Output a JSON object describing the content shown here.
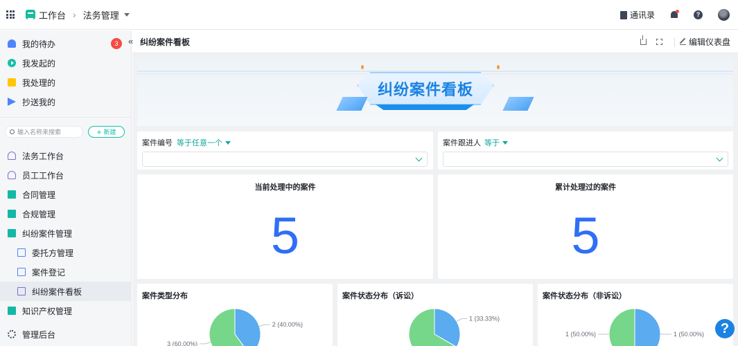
{
  "topbar": {
    "app_name": "工作台",
    "breadcrumb": "法务管理",
    "contacts_label": "通讯录",
    "icons": [
      "apps-grid-icon",
      "workbench-logo-icon",
      "chevron-right-icon",
      "caret-down-icon",
      "contacts-book-icon",
      "notification-bell-icon",
      "help-icon",
      "user-avatar"
    ]
  },
  "sidebar": {
    "quick_items": [
      {
        "label": "我的待办",
        "icon": "bell-icon",
        "badge": "3"
      },
      {
        "label": "我发起的",
        "icon": "play-circle-icon"
      },
      {
        "label": "我处理的",
        "icon": "check-box-icon"
      },
      {
        "label": "抄送我的",
        "icon": "send-icon"
      }
    ],
    "search_placeholder": "输入名称来搜索",
    "new_button": "新建",
    "nav_items": [
      {
        "label": "法务工作台",
        "icon": "user-icon"
      },
      {
        "label": "员工工作台",
        "icon": "user-icon"
      },
      {
        "label": "合同管理",
        "icon": "folder-icon"
      },
      {
        "label": "合规管理",
        "icon": "folder-icon"
      },
      {
        "label": "纠纷案件管理",
        "icon": "folder-icon"
      },
      {
        "label": "委托方管理",
        "icon": "document-icon"
      },
      {
        "label": "案件登记",
        "icon": "document-icon"
      },
      {
        "label": "纠纷案件看板",
        "icon": "dashboard-icon",
        "active": true
      },
      {
        "label": "知识产权管理",
        "icon": "folder-icon"
      }
    ],
    "admin_label": "管理后台"
  },
  "header": {
    "title": "纠纷案件看板",
    "edit_label": "编辑仪表盘"
  },
  "banner": {
    "title": "纠纷案件看板"
  },
  "filters": [
    {
      "label": "案件编号",
      "operator": "等于任意一个"
    },
    {
      "label": "案件跟进人",
      "operator": "等于"
    }
  ],
  "metrics": [
    {
      "title": "当前处理中的案件",
      "value": "5"
    },
    {
      "title": "累计处理过的案件",
      "value": "5"
    }
  ],
  "chart_data": [
    {
      "type": "pie",
      "title": "案件类型分布",
      "slices": [
        {
          "value": 2,
          "label": "2 (40.00%)",
          "color": "#5aabf0"
        },
        {
          "value": 3,
          "label": "3 (60.00%)",
          "color": "#76d68a"
        }
      ]
    },
    {
      "type": "pie",
      "title": "案件状态分布（诉讼）",
      "slices": [
        {
          "value": 1,
          "label": "1 (33.33%)",
          "color": "#5aabf0"
        },
        {
          "value": 2,
          "label": "",
          "color": "#76d68a"
        }
      ]
    },
    {
      "type": "pie",
      "title": "案件状态分布（非诉讼）",
      "slices": [
        {
          "value": 1,
          "label": "1 (50.00%)",
          "color": "#5aabf0"
        },
        {
          "value": 1,
          "label": "1 (50.00%)",
          "color": "#76d68a"
        }
      ]
    }
  ],
  "help_fab": "?"
}
